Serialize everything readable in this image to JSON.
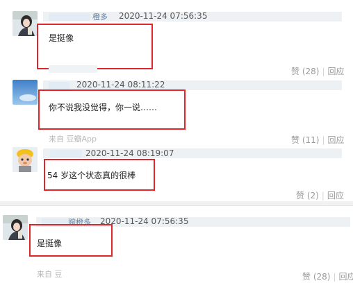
{
  "comments": [
    {
      "name": "橙多",
      "time": "2020-11-24 07:56:35",
      "text": "是挺像",
      "source": "",
      "like_label": "赞",
      "like_count": "(28)",
      "reply_label": "回应"
    },
    {
      "name": "",
      "time": "2020-11-24 08:11:22",
      "text": "你不说我没觉得，你一说……",
      "source": "来自 豆瓣App",
      "like_label": "赞",
      "like_count": "(11)",
      "reply_label": "回应"
    },
    {
      "name": "",
      "time": "2020-11-24 08:19:07",
      "text": "54 岁这个状态真的很棒",
      "source": "",
      "like_label": "赞",
      "like_count": "(2)",
      "reply_label": "回应"
    },
    {
      "name": "豌橙多",
      "time": "2020-11-24 07:56:35",
      "text": "是挺像",
      "source": "来自 豆",
      "like_label": "赞",
      "like_count": "(28)",
      "reply_label": "回应"
    }
  ],
  "colors": {
    "highlight_border": "#e0262b",
    "username": "#5c7fa6",
    "meta_bar": "#eef1f3"
  },
  "icons": [
    "avatar-woman",
    "avatar-blue-sky",
    "avatar-cartoon-doll",
    "avatar-woman"
  ]
}
